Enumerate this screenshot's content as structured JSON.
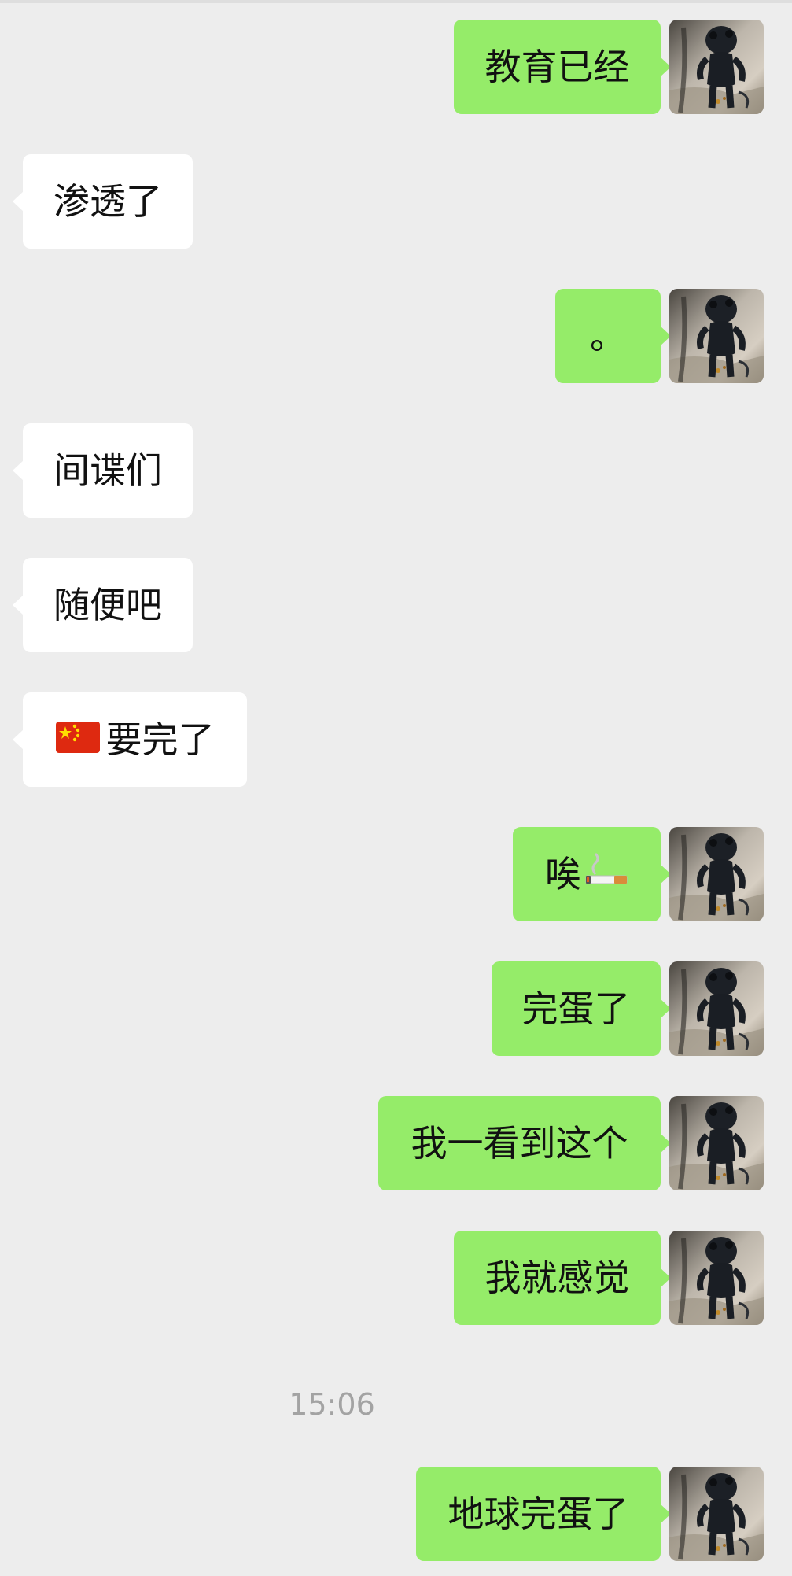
{
  "chat": {
    "messages": [
      {
        "text": "教育已经",
        "side": "right"
      },
      {
        "text": "渗透了",
        "side": "left"
      },
      {
        "text": "。",
        "side": "right"
      },
      {
        "text": "间谍们",
        "side": "left"
      },
      {
        "text": "随便吧",
        "side": "left"
      },
      {
        "text": "要完了",
        "side": "left",
        "leading_icon": "china-flag-icon"
      },
      {
        "text": "唉",
        "side": "right",
        "trailing_icon": "cigarette-icon"
      },
      {
        "text": "完蛋了",
        "side": "right"
      },
      {
        "text": "我一看到这个",
        "side": "right"
      },
      {
        "text": "我就感觉",
        "side": "right"
      },
      {
        "text": "地球完蛋了",
        "side": "right"
      }
    ],
    "timestamp": "15:06"
  },
  "colors": {
    "background": "#ededed",
    "outgoing_bubble": "#95ec69",
    "incoming_bubble": "#ffffff",
    "timestamp_text": "#a3a3a3"
  },
  "avatar": {
    "icon": "robot-avatar-icon"
  }
}
